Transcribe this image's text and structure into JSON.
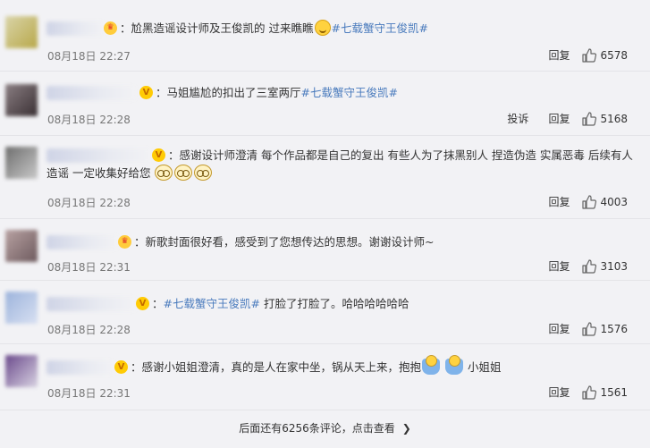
{
  "comments": [
    {
      "badge": "crown",
      "parts": [
        {
          "t": "：",
          "c": "name-colon"
        },
        {
          "t": "尬黑造谣设计师及王俊凯的 过来瞧瞧",
          "c": ""
        },
        {
          "e": "smile"
        },
        {
          "t": "#七载蟹守王俊凯#",
          "c": "topic"
        }
      ],
      "time": "08月18日 22:27",
      "actions": [
        "回复"
      ],
      "likes": "6578",
      "avatar": [
        "#d9d4a8",
        "#b8a84a"
      ]
    },
    {
      "badge": "vip",
      "parts": [
        {
          "t": "：马姐尴尬的扣出了三室两厅",
          "c": ""
        },
        {
          "t": "#七载蟹守王俊凯#",
          "c": "topic"
        }
      ],
      "time": "08月18日 22:28",
      "actions": [
        "投诉",
        "回复"
      ],
      "likes": "5168",
      "avatar": [
        "#8a7e82",
        "#3a3034"
      ]
    },
    {
      "badge": "vip",
      "wrap": true,
      "parts": [
        {
          "t": "：感谢设计师澄清 每个作品都是自己的复出 有些人为了抹黑别人 捏造伪造 实属恶毒 后续有人造谣 一定收集好给您 ",
          "c": ""
        },
        {
          "e": "wow"
        },
        {
          "e": "wow"
        },
        {
          "e": "wow"
        }
      ],
      "time": "08月18日 22:28",
      "actions": [
        "回复"
      ],
      "likes": "4003",
      "avatar": [
        "#6e6e6e",
        "#c9c9c9"
      ]
    },
    {
      "badge": "crown",
      "parts": [
        {
          "t": "：新歌封面很好看，感受到了您想传达的思想。谢谢设计师~",
          "c": ""
        }
      ],
      "time": "08月18日 22:31",
      "actions": [
        "回复"
      ],
      "likes": "3103",
      "avatar": [
        "#b8a2a2",
        "#6d5a5e"
      ]
    },
    {
      "badge": "vip",
      "parts": [
        {
          "t": "：",
          "c": "name-colon"
        },
        {
          "t": "#七载蟹守王俊凯#",
          "c": "topic"
        },
        {
          "t": " 打脸了打脸了。哈哈哈哈哈哈",
          "c": ""
        }
      ],
      "time": "08月18日 22:28",
      "actions": [
        "回复"
      ],
      "likes": "1576",
      "avatar": [
        "#9db4dc",
        "#d8e0f2"
      ]
    },
    {
      "badge": "vip",
      "parts": [
        {
          "t": "：感谢小姐姐澄清，真的是人在家中坐，锅从天上来，抱抱",
          "c": ""
        },
        {
          "e": "hug"
        },
        {
          "t": " ",
          "c": ""
        },
        {
          "e": "hug"
        },
        {
          "t": " 小姐姐",
          "c": ""
        }
      ],
      "time": "08月18日 22:31",
      "actions": [
        "回复"
      ],
      "likes": "1561",
      "avatar": [
        "#6b4a8c",
        "#d8d2e2"
      ]
    }
  ],
  "footer": {
    "more_text": "后面还有6256条评论，点击查看"
  }
}
